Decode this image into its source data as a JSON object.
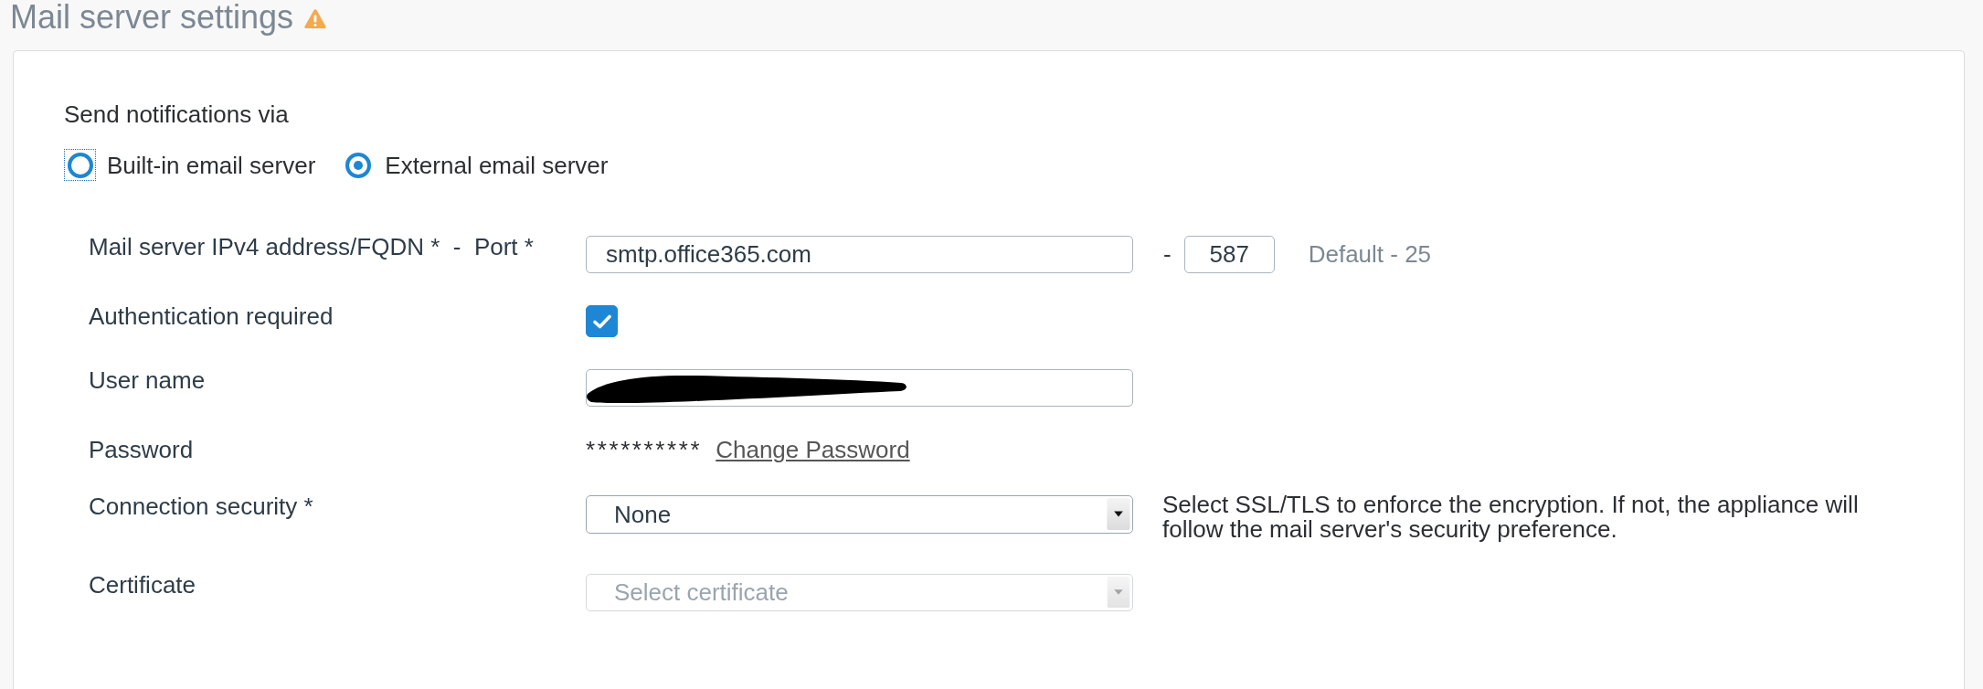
{
  "page": {
    "title": "Mail server settings",
    "warning": true
  },
  "send_via": {
    "label": "Send notifications via",
    "options": [
      {
        "label": "Built-in email server",
        "selected": false,
        "focused": true
      },
      {
        "label": "External email server",
        "selected": true,
        "focused": false
      }
    ]
  },
  "fields": [
    {
      "kind": "host_port",
      "label": "Mail server IPv4 address/FQDN *  -  Port *",
      "value": "smtp.office365.com",
      "separator": "-",
      "port": "587",
      "hint": "Default - 25"
    },
    {
      "kind": "checkbox",
      "label": "Authentication required",
      "checked": true
    },
    {
      "kind": "text",
      "label": "User name",
      "redacted": true
    },
    {
      "kind": "password",
      "label": "Password",
      "masked": "**********",
      "link": "Change Password"
    },
    {
      "kind": "select",
      "label": "Connection security *",
      "value": "None",
      "disabled": false,
      "help": "Select SSL/TLS to enforce the encryption. If not, the appliance will follow the mail server's security preference."
    },
    {
      "kind": "select",
      "label": "Certificate",
      "placeholder": "Select certificate",
      "disabled": true
    }
  ]
}
